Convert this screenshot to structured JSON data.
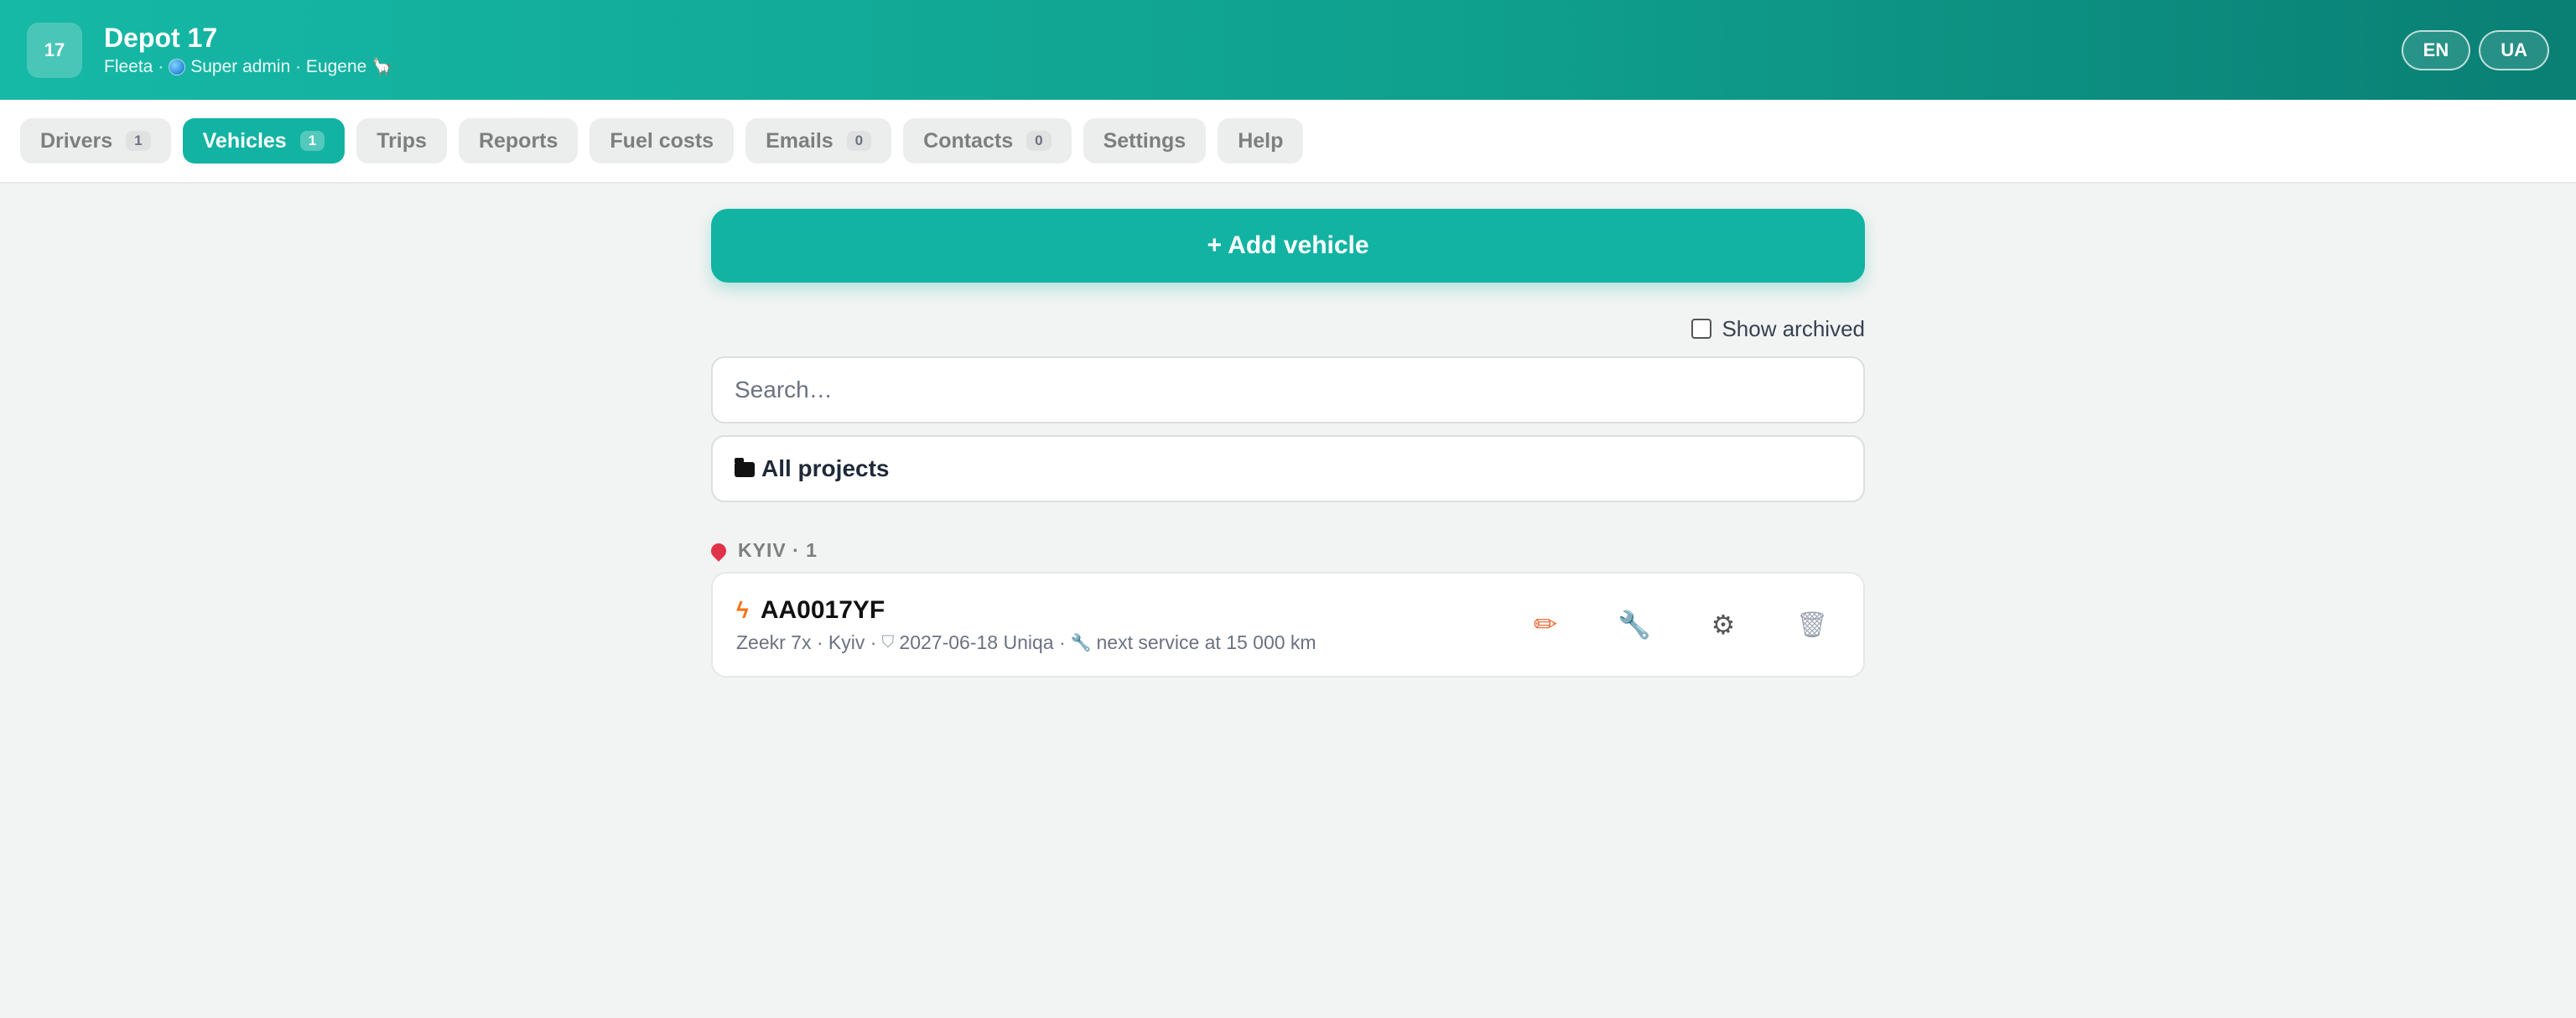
{
  "header": {
    "logo_text": "17",
    "title": "Depot 17",
    "subtitle_app": "Fleeta ·",
    "subtitle_role": "Super admin · Eugene",
    "subtitle_emoji": "🦙",
    "languages": [
      "EN",
      "UA"
    ]
  },
  "tabs": [
    {
      "label": "Drivers",
      "count": "1"
    },
    {
      "label": "Vehicles",
      "count": "1"
    },
    {
      "label": "Trips"
    },
    {
      "label": "Reports"
    },
    {
      "label": "Fuel costs"
    },
    {
      "label": "Emails",
      "count": "0"
    },
    {
      "label": "Contacts",
      "count": "0"
    },
    {
      "label": "Settings"
    },
    {
      "label": "Help"
    }
  ],
  "main": {
    "add_button_label": "+ Add vehicle",
    "show_archived_label": "Show archived",
    "search_placeholder": "Search…",
    "project_filter": "All projects",
    "group": {
      "title": "KYIV · 1",
      "vehicles": [
        {
          "plate": "AA0017YF",
          "model_city": "Zeekr 7x · Kyiv ·",
          "insurance": "2027-06-18 Uniqa ·",
          "service": "next service at 15 000 km"
        }
      ]
    }
  },
  "colors": {
    "accent": "#12b3a3",
    "header_start": "#16b8a6",
    "header_end": "#0a7f74",
    "edit_icon": "#f26b3a"
  },
  "icons": {
    "vehicle_type": "bolt-icon",
    "edit": "pencil-icon",
    "service": "wrench-icon",
    "settings": "gear-icon",
    "delete": "trash-icon"
  }
}
